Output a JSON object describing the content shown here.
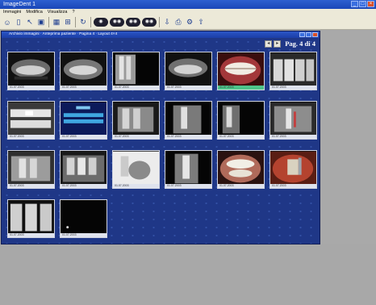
{
  "app": {
    "title": "ImageDent 1",
    "minimize": "_",
    "maximize": "□",
    "close": "×"
  },
  "menu": [
    "Immagini",
    "Modifica",
    "Visualizza",
    "?"
  ],
  "viewer": {
    "title": "Archivio immagini · Anteprima paziente · Pagina 4 · Layout 4×4",
    "pager_label": "Pag. 4 di 4"
  },
  "thumbnails": [
    {
      "caption": "01.07.2003"
    },
    {
      "caption": "01.07.2003"
    },
    {
      "caption": "01.07.2003"
    },
    {
      "caption": "01.07.2003"
    },
    {
      "caption": "01.07.2003"
    },
    {
      "caption": "01.07.2003"
    },
    {
      "caption": "01.07.2003"
    },
    {
      "caption": "01.07.2003"
    },
    {
      "caption": "01.07.2003"
    },
    {
      "caption": "01.07.2003"
    },
    {
      "caption": "01.07.2003"
    },
    {
      "caption": "01.07.2003"
    },
    {
      "caption": "01.07.2003"
    },
    {
      "caption": "01.07.2003"
    },
    {
      "caption": "01.07.2003"
    },
    {
      "caption": "01.07.2003"
    },
    {
      "caption": "01.07.2003"
    },
    {
      "caption": "01.07.2003"
    },
    {
      "caption": "01.07.2003"
    },
    {
      "caption": "01.07.2003"
    }
  ],
  "selected_thumbnail_index": 4,
  "context_toolbar_icons": [
    "save-icon",
    "settings-icon",
    "brush-icon",
    "user-icon",
    "camera-icon",
    "rotate-icon"
  ],
  "colors": {
    "desktop_bg": "#1f3787",
    "selection": "#4ec48a",
    "titlebar": "#1a47b8"
  }
}
